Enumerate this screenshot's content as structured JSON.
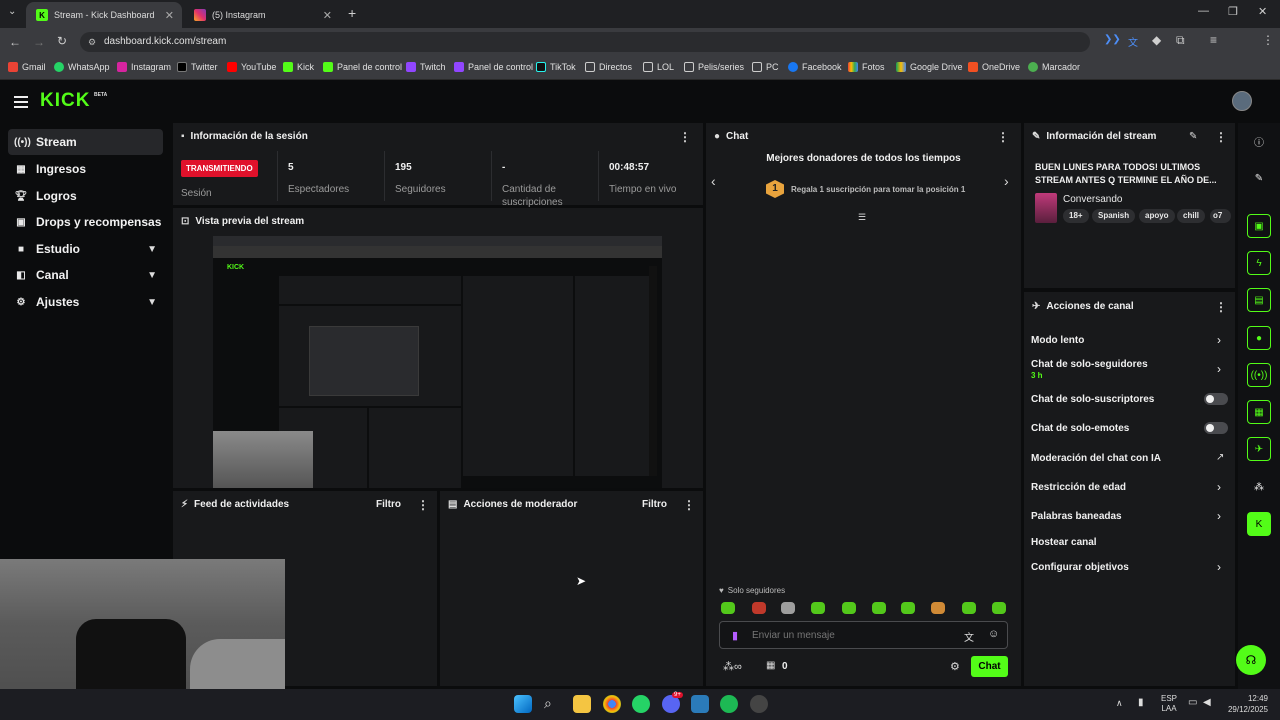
{
  "browser": {
    "tabs": [
      {
        "title": "Stream - Kick Dashboard",
        "active": true
      },
      {
        "title": "(5) Instagram",
        "active": false
      }
    ],
    "url": "dashboard.kick.com/stream",
    "bookmarks": [
      "Gmail",
      "WhatsApp",
      "Instagram",
      "Twitter",
      "YouTube",
      "Kick",
      "Panel de control",
      "Twitch",
      "Panel de control",
      "TikTok",
      "Directos",
      "LOL",
      "Pelis/series",
      "PC",
      "Facebook",
      "Fotos",
      "Google Drive",
      "OneDrive",
      "Marcador"
    ]
  },
  "kick": {
    "logo": "KICK",
    "beta": "BETA",
    "nav": [
      {
        "label": "Stream",
        "icon": "stream-icon"
      },
      {
        "label": "Ingresos",
        "icon": "money-icon"
      },
      {
        "label": "Logros",
        "icon": "trophy-icon"
      },
      {
        "label": "Drops y recompensas",
        "icon": "gift-icon"
      },
      {
        "label": "Estudio",
        "icon": "camera-icon"
      },
      {
        "label": "Canal",
        "icon": "channel-icon"
      },
      {
        "label": "Ajustes",
        "icon": "gear-icon"
      }
    ]
  },
  "session": {
    "title": "Información de la sesión",
    "status": "TRANSMITIENDO",
    "status_label": "Sesión",
    "viewers": "5",
    "viewers_label": "Espectadores",
    "followers": "195",
    "followers_label": "Seguidores",
    "subs": "-",
    "subs_label": "Cantidad de suscripciones",
    "time": "00:48:57",
    "time_label": "Tiempo en vivo"
  },
  "preview": {
    "title": "Vista previa del stream"
  },
  "activity": {
    "title": "Feed de actividades",
    "filter": "Filtro"
  },
  "moderator": {
    "title": "Acciones de moderador",
    "filter": "Filtro"
  },
  "chat": {
    "title": "Chat",
    "donors_title": "Mejores donadores de todos los tiempos",
    "rank": "1",
    "donors_text": "Regala 1 suscripción para tomar la posición 1",
    "followers_only": "Solo seguidores",
    "placeholder": "Enviar un mensaje",
    "points": "0",
    "send": "Chat"
  },
  "stream_info": {
    "title": "Información del stream",
    "stream_title": "BUEN LUNES PARA TODOS! ULTIMOS STREAM ANTES Q TERMINE EL AÑO DE...",
    "category": "Conversando",
    "tags": [
      "18+",
      "Spanish",
      "apoyo",
      "chill",
      "o7"
    ]
  },
  "actions": {
    "title": "Acciones de canal",
    "items": [
      {
        "label": "Modo lento"
      },
      {
        "label": "Chat de solo-seguidores",
        "sub": "3 h"
      },
      {
        "label": "Chat de solo-suscriptores"
      },
      {
        "label": "Chat de solo-emotes"
      },
      {
        "label": "Moderación del chat con IA"
      },
      {
        "label": "Restricción de edad"
      },
      {
        "label": "Palabras baneadas"
      },
      {
        "label": "Hostear canal"
      },
      {
        "label": "Configurar objetivos"
      }
    ]
  },
  "taskbar": {
    "lang1": "ESP",
    "lang2": "LAA",
    "time": "12:49",
    "date": "29/12/2025",
    "badge": "9+"
  },
  "colors": {
    "accent": "#53fc18",
    "live": "#e0112b",
    "panel": "#18191b",
    "bg": "#0b0c0d"
  }
}
